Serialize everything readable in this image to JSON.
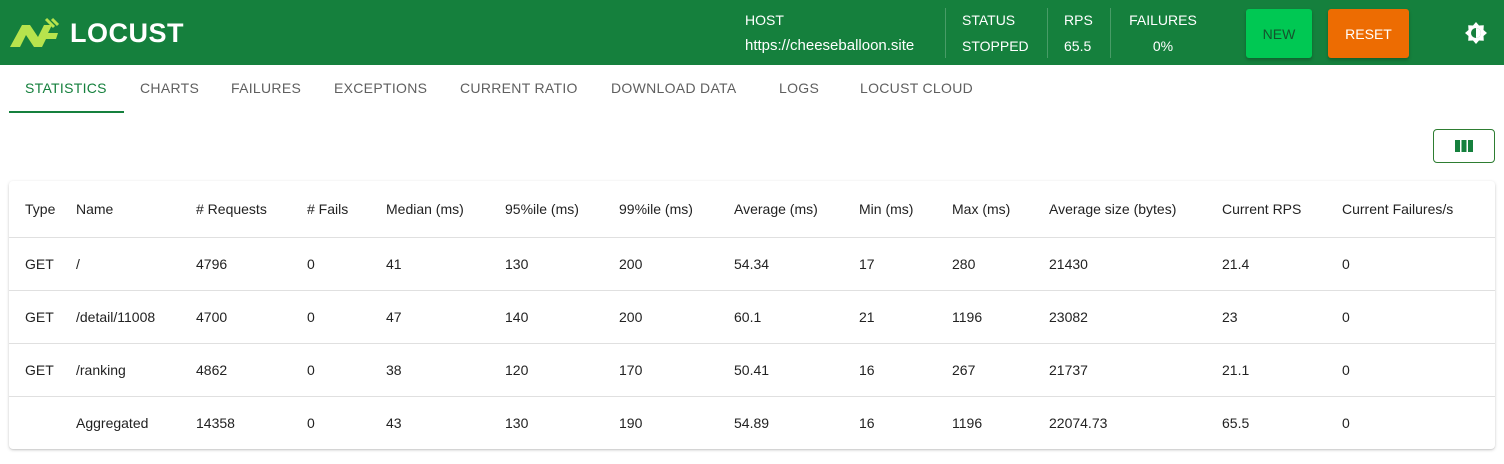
{
  "app": {
    "name": "LOCUST",
    "brand_color": "#15803d"
  },
  "header": {
    "host_label": "HOST",
    "host_value": "https://cheeseballoon.site",
    "status_label": "STATUS",
    "status_value": "STOPPED",
    "rps_label": "RPS",
    "rps_value": "65.5",
    "failures_label": "FAILURES",
    "failures_value": "0%",
    "new_button": "NEW",
    "reset_button": "RESET",
    "theme_icon": "brightness-icon"
  },
  "tabs": [
    {
      "label": "STATISTICS",
      "active": true
    },
    {
      "label": "CHARTS"
    },
    {
      "label": "FAILURES"
    },
    {
      "label": "EXCEPTIONS"
    },
    {
      "label": "CURRENT RATIO"
    },
    {
      "label": "DOWNLOAD DATA"
    },
    {
      "label": "LOGS"
    },
    {
      "label": "LOCUST CLOUD"
    }
  ],
  "toolbar": {
    "columns_icon": "view-columns-icon"
  },
  "table": {
    "columns": [
      "Type",
      "Name",
      "# Requests",
      "# Fails",
      "Median (ms)",
      "95%ile (ms)",
      "99%ile (ms)",
      "Average (ms)",
      "Min (ms)",
      "Max (ms)",
      "Average size (bytes)",
      "Current RPS",
      "Current Failures/s"
    ],
    "rows": [
      [
        "GET",
        "/",
        "4796",
        "0",
        "41",
        "130",
        "200",
        "54.34",
        "17",
        "280",
        "21430",
        "21.4",
        "0"
      ],
      [
        "GET",
        "/detail/11008",
        "4700",
        "0",
        "47",
        "140",
        "200",
        "60.1",
        "21",
        "1196",
        "23082",
        "23",
        "0"
      ],
      [
        "GET",
        "/ranking",
        "4862",
        "0",
        "38",
        "120",
        "170",
        "50.41",
        "16",
        "267",
        "21737",
        "21.1",
        "0"
      ],
      [
        "",
        "Aggregated",
        "14358",
        "0",
        "43",
        "130",
        "190",
        "54.89",
        "16",
        "1196",
        "22074.73",
        "65.5",
        "0"
      ]
    ]
  }
}
